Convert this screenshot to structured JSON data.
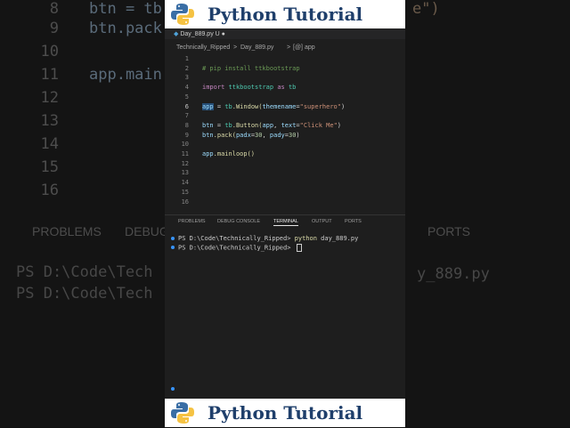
{
  "banner": {
    "title": "Python Tutorial"
  },
  "editor": {
    "tab_label": "Day_889.py U",
    "breadcrumbs": [
      "Technically_Ripped",
      ">",
      "Day_889.py",
      ">",
      "[@] app"
    ],
    "line_numbers": [
      "1",
      "2",
      "3",
      "4",
      "5",
      "6",
      "7",
      "8",
      "9",
      "10",
      "11",
      "12",
      "13",
      "14",
      "15",
      "16"
    ],
    "active_line": "6",
    "lines": {
      "l2": "# pip install ttkbootstrap",
      "l4": {
        "kw1": "import",
        "mod": "ttkbootstrap",
        "kw2": "as",
        "alias": "tb"
      },
      "l6": {
        "var": "app",
        "eq": " = ",
        "obj": "tb",
        "fn": ".Window(",
        "param": "themename",
        "eq2": "=",
        "str": "\"superhero\"",
        "close": ")"
      },
      "l8": {
        "var": "btn",
        "eq": " = ",
        "obj": "tb",
        "fn": ".Button(",
        "arg": "app",
        "comma": ", ",
        "param": "text",
        "eq2": "=",
        "str": "\"Click Me\"",
        "close": ")"
      },
      "l9": {
        "var": "btn",
        "fn": ".pack(",
        "p1": "padx",
        "eq1": "=",
        "n1": "30",
        "comma": ", ",
        "p2": "pady",
        "eq2": "=",
        "n2": "30",
        "close": ")"
      },
      "l11": {
        "var": "app",
        "fn": ".mainloop()"
      }
    }
  },
  "panel": {
    "tabs": [
      "PROBLEMS",
      "DEBUG CONSOLE",
      "TERMINAL",
      "OUTPUT",
      "PORTS"
    ],
    "active_tab": "TERMINAL"
  },
  "terminal": {
    "line1_prompt": "PS D:\\Code\\Technically_Ripped> ",
    "line1_cmd": "python",
    "line1_arg": " day_889.py",
    "line2_prompt": "PS D:\\Code\\Technically_Ripped> "
  },
  "background": {
    "line_numbers": [
      "8",
      "9",
      "10",
      "11",
      "12",
      "13",
      "14",
      "15",
      "16"
    ],
    "code_lines": [
      "btn = tb",
      "btn.pack",
      "",
      "app.main",
      "",
      "",
      "",
      "",
      ""
    ],
    "right_code": "e\")",
    "tabs": [
      "PROBLEMS",
      "DEBUG",
      "PORTS"
    ],
    "term_lines": [
      "PS D:\\Code\\Tech",
      "PS D:\\Code\\Tech"
    ],
    "term_right": "y_889.py"
  },
  "colors": {
    "accent": "#3794ff",
    "banner_text": "#1f3f6b",
    "editor_bg": "#1e1e1e"
  }
}
